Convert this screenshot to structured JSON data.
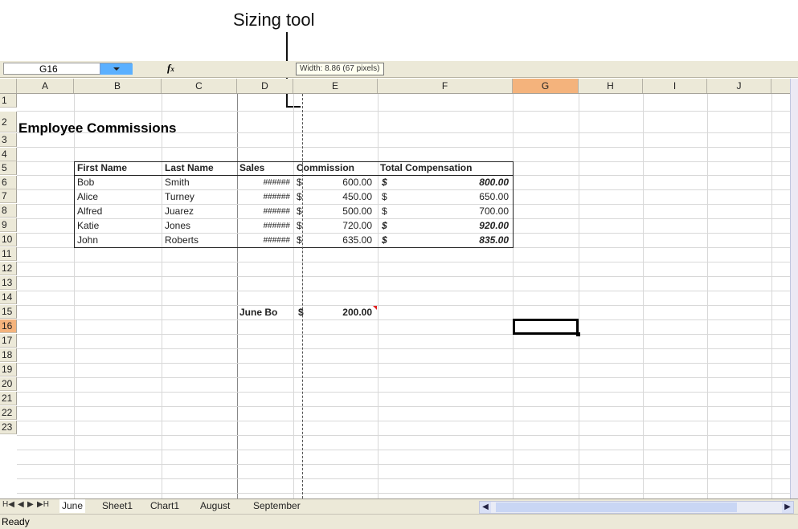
{
  "callout": {
    "label": "Sizing tool"
  },
  "formula_bar": {
    "name_box": "G16",
    "fx_icon": "fx-icon",
    "tooltip": "Width: 8.86 (67 pixels)"
  },
  "columns": [
    "A",
    "B",
    "C",
    "D",
    "E",
    "F",
    "G",
    "H",
    "I",
    "J"
  ],
  "selected_column": "G",
  "rows": [
    "1",
    "2",
    "3",
    "4",
    "5",
    "6",
    "7",
    "8",
    "9",
    "10",
    "11",
    "12",
    "13",
    "14",
    "15",
    "16",
    "17",
    "18",
    "19",
    "20",
    "21",
    "22",
    "23"
  ],
  "selected_row": "16",
  "sheet": {
    "title": "Employee Commissions",
    "headers": [
      "First Name",
      "Last Name",
      "Sales",
      "Commission",
      "Total Compensation"
    ],
    "data": [
      {
        "first": "Bob",
        "last": "Smith",
        "sales": "######",
        "comm_cur": "$",
        "comm": "600.00",
        "tot_cur": "$",
        "total": "800.00",
        "emph": true
      },
      {
        "first": "Alice",
        "last": "Turney",
        "sales": "######",
        "comm_cur": "$",
        "comm": "450.00",
        "tot_cur": "$",
        "total": "650.00",
        "emph": false
      },
      {
        "first": "Alfred",
        "last": "Juarez",
        "sales": "######",
        "comm_cur": "$",
        "comm": "500.00",
        "tot_cur": "$",
        "total": "700.00",
        "emph": false
      },
      {
        "first": "Katie",
        "last": "Jones",
        "sales": "######",
        "comm_cur": "$",
        "comm": "720.00",
        "tot_cur": "$",
        "total": "920.00",
        "emph": true
      },
      {
        "first": "John",
        "last": "Roberts",
        "sales": "######",
        "comm_cur": "$",
        "comm": "635.00",
        "tot_cur": "$",
        "total": "835.00",
        "emph": true
      }
    ],
    "bonus_label": "June Bo",
    "bonus_cur": "$",
    "bonus_value": "200.00"
  },
  "tabs": {
    "nav_first": "H◀",
    "nav_prev": "◀",
    "nav_next": "▶",
    "nav_last": "▶H",
    "items": [
      "June",
      "Sheet1",
      "Chart1",
      "August",
      "September"
    ],
    "active": "June"
  },
  "status": {
    "text": "Ready"
  }
}
